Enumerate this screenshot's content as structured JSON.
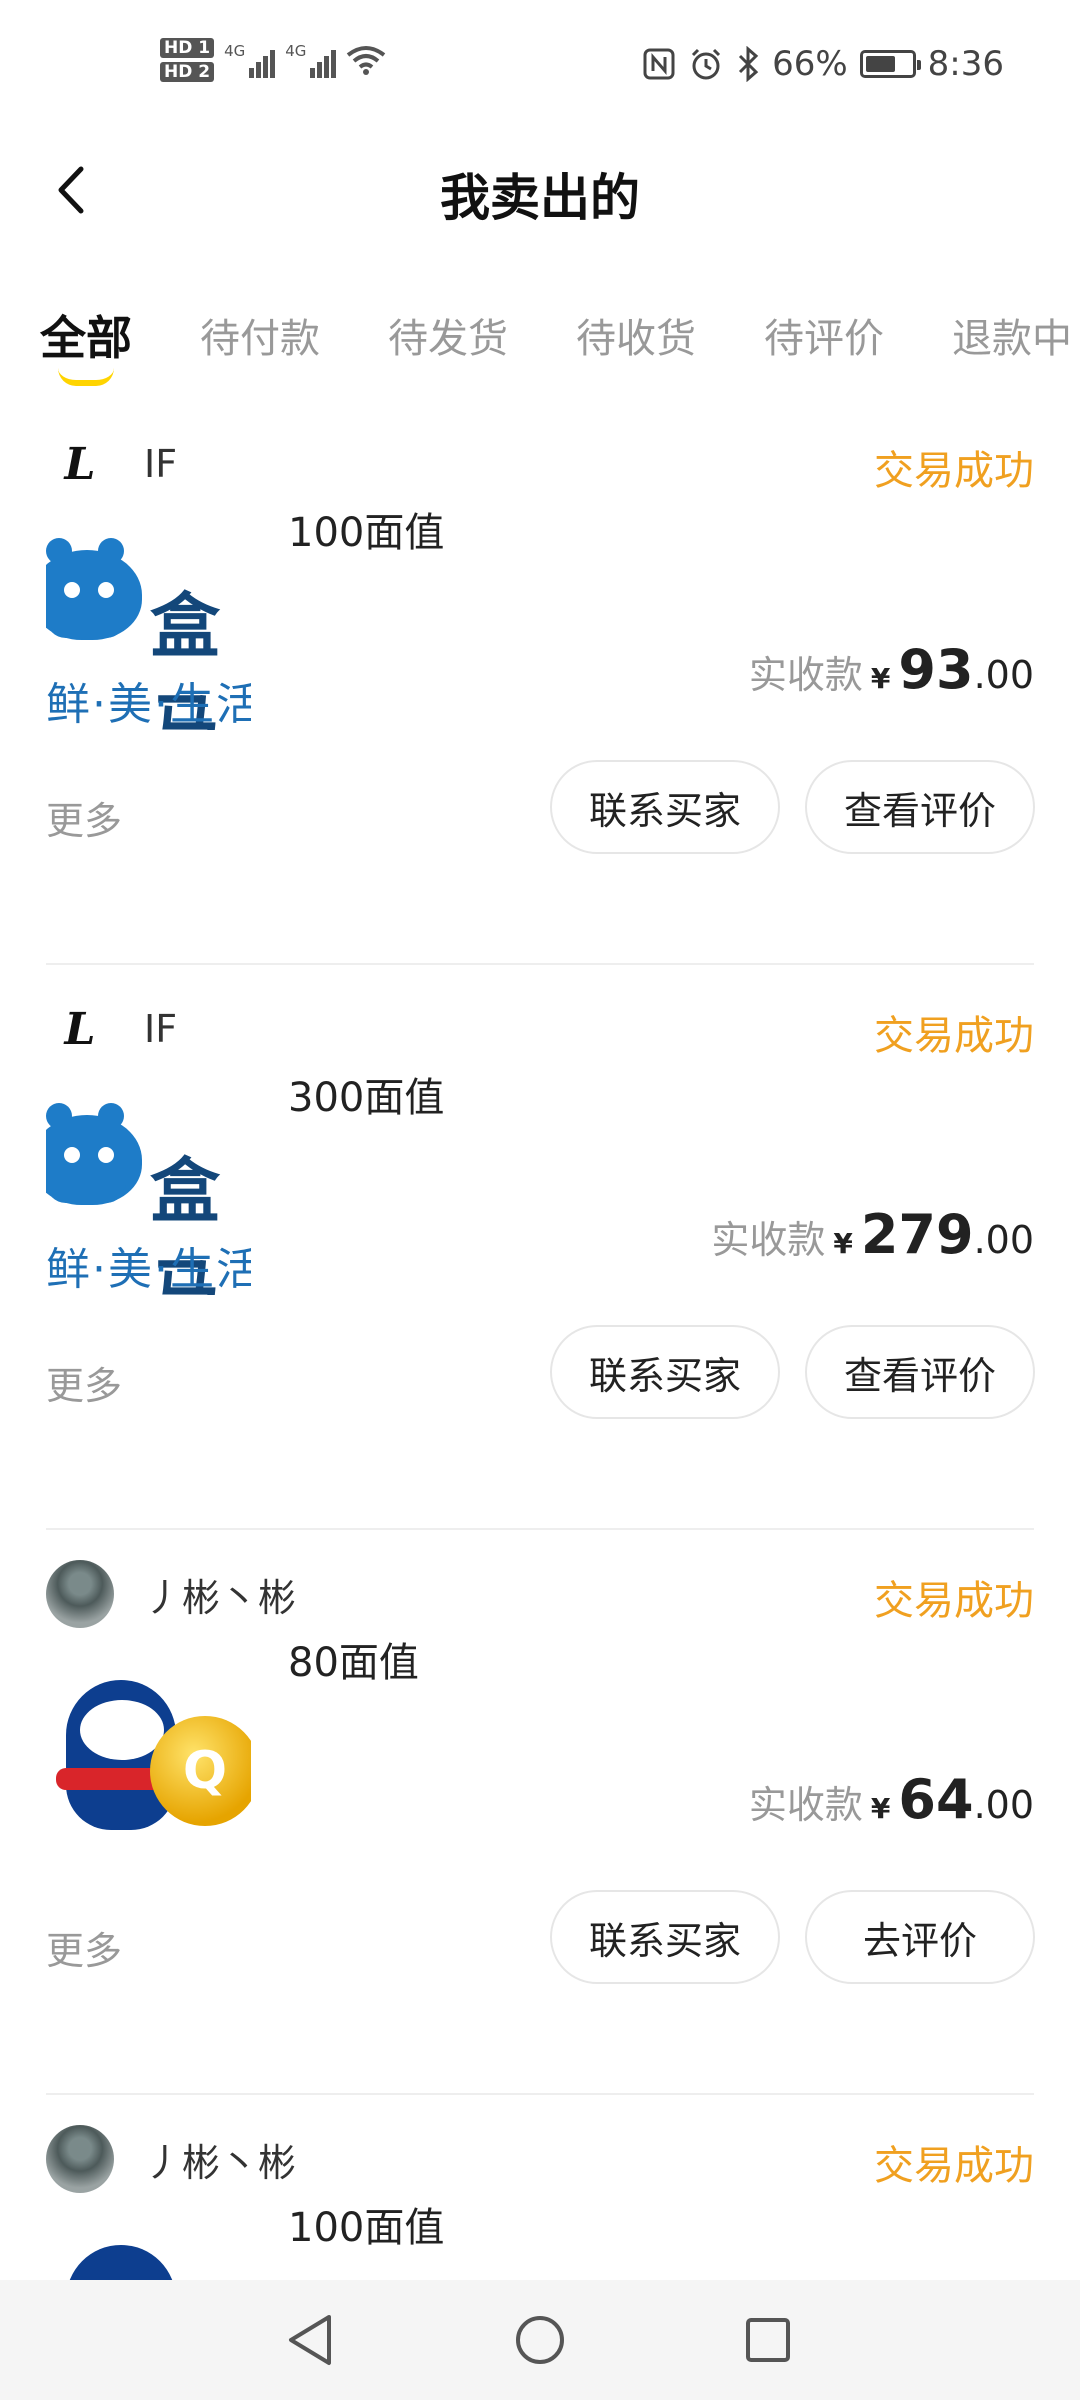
{
  "status_bar": {
    "hd1": "HD 1",
    "hd2": "HD 2",
    "net1": "4G",
    "net2": "4G",
    "battery_pct": "66%",
    "battery_level": 0.66,
    "time": "8:36"
  },
  "header": {
    "title": "我卖出的"
  },
  "tabs": [
    {
      "label": "全部"
    },
    {
      "label": "待付款"
    },
    {
      "label": "待发货"
    },
    {
      "label": "待收货"
    },
    {
      "label": "待评价"
    },
    {
      "label": "退款中"
    }
  ],
  "orders": [
    {
      "seller": "IF",
      "avatar_letter": "L",
      "status": "交易成功",
      "thumb_brand": "盒马",
      "thumb_tag": "鲜·美·生活",
      "title": "100面值",
      "price_label": "实收款",
      "currency": "¥",
      "price_int": "93",
      "price_dec": ".00",
      "more": "更多",
      "btn_contact": "联系买家",
      "btn_review": "查看评价"
    },
    {
      "seller": "IF",
      "avatar_letter": "L",
      "status": "交易成功",
      "thumb_brand": "盒马",
      "thumb_tag": "鲜·美·生活",
      "title": "300面值",
      "price_label": "实收款",
      "currency": "¥",
      "price_int": "279",
      "price_dec": ".00",
      "more": "更多",
      "btn_contact": "联系买家",
      "btn_review": "查看评价"
    },
    {
      "seller": "丿彬丶彬",
      "status": "交易成功",
      "thumb_coin": "Q",
      "title": "80面值",
      "price_label": "实收款",
      "currency": "¥",
      "price_int": "64",
      "price_dec": ".00",
      "more": "更多",
      "btn_contact": "联系买家",
      "btn_review": "去评价"
    },
    {
      "seller": "丿彬丶彬",
      "status": "交易成功",
      "title": "100面值"
    }
  ]
}
